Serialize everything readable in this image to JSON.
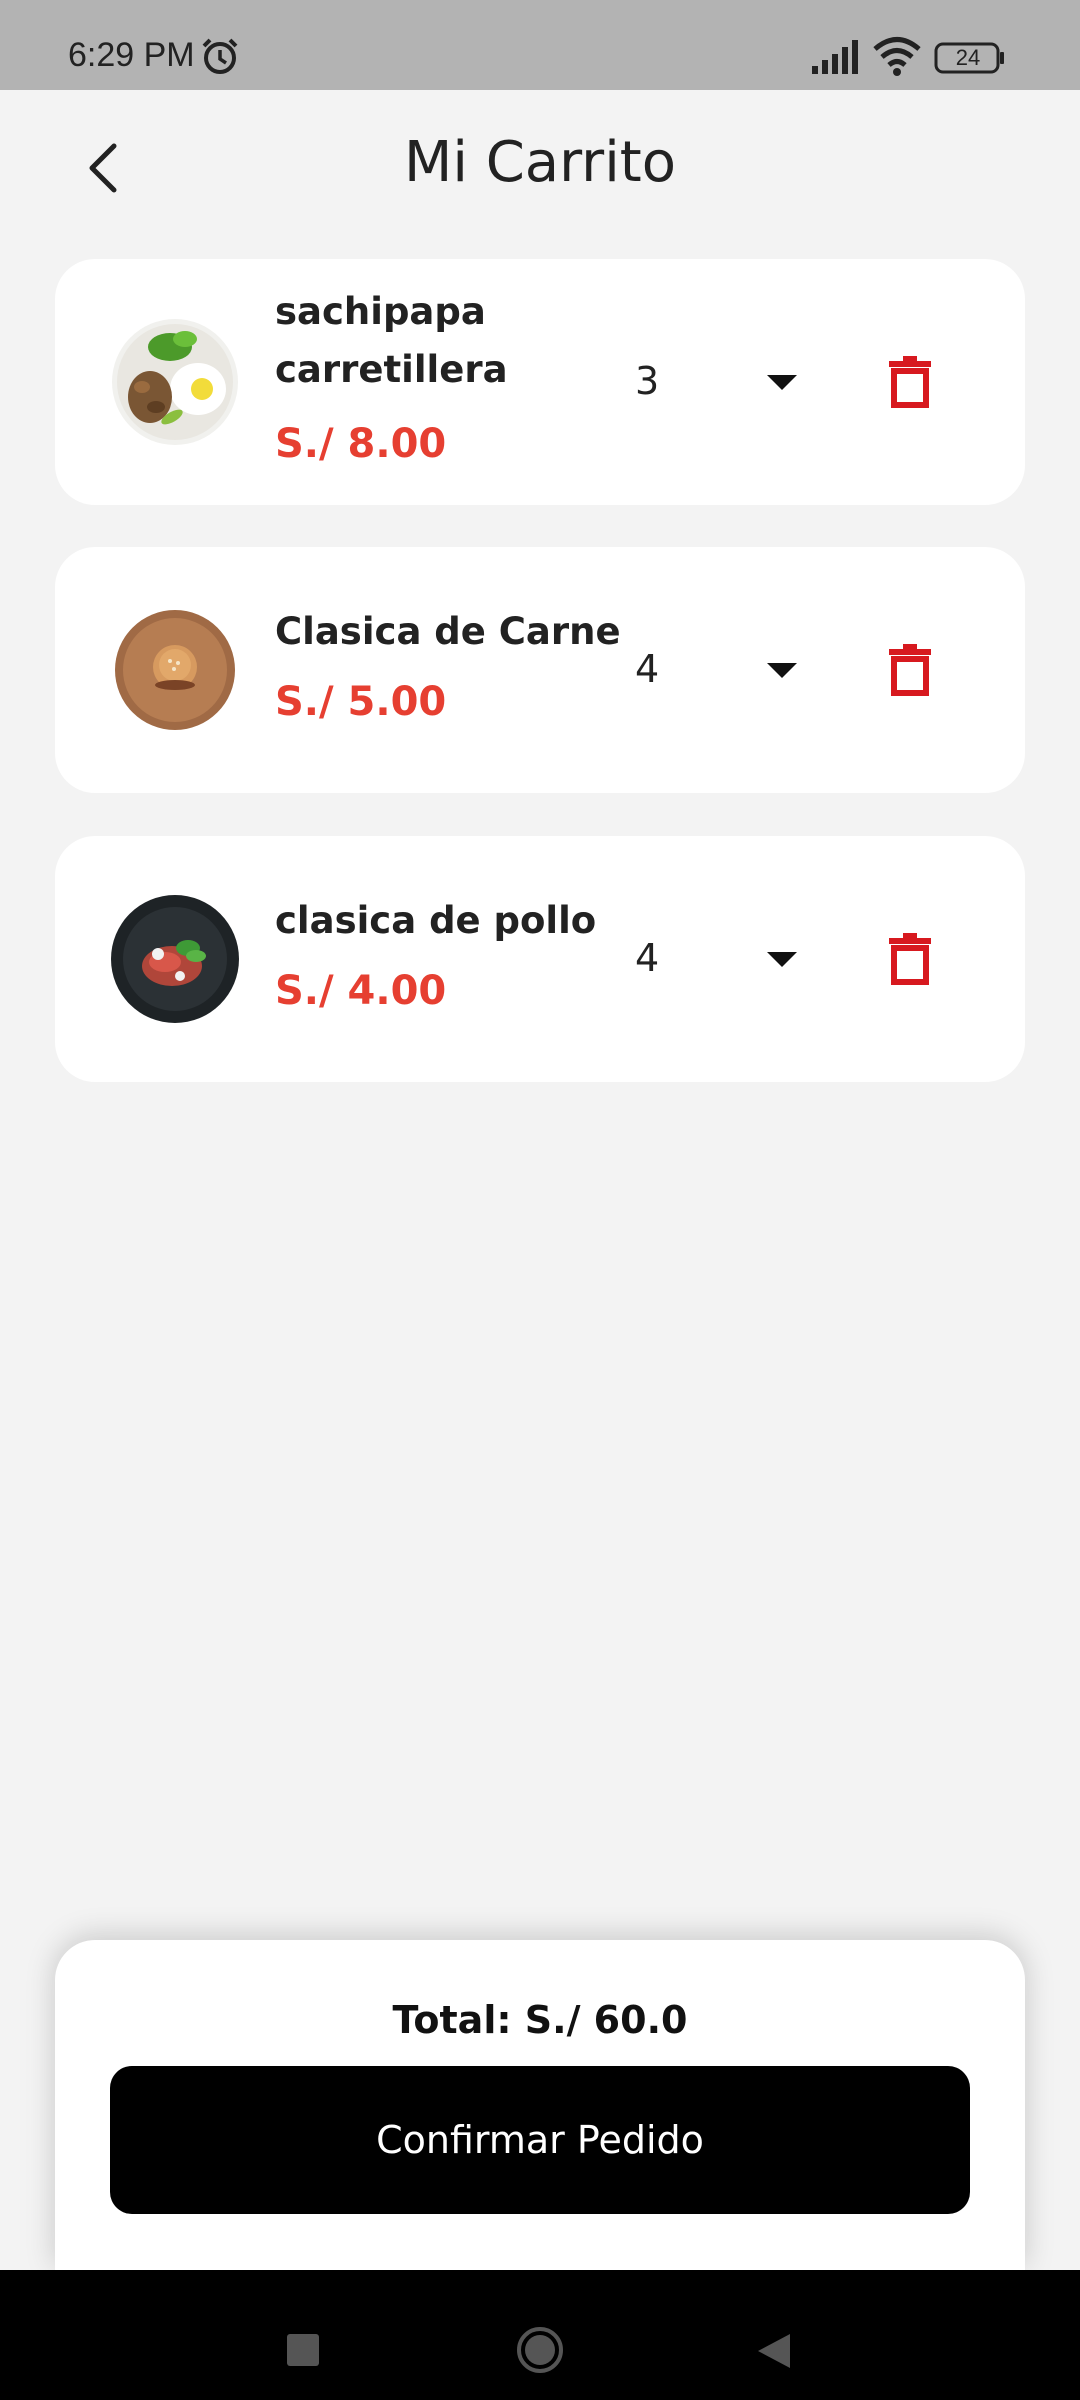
{
  "status_bar": {
    "time": "6:29 PM",
    "battery": "24",
    "icons": [
      "alarm-icon",
      "signal-icon",
      "wifi-icon",
      "battery-icon"
    ]
  },
  "header": {
    "title": "Mi Carrito",
    "back_icon": "chevron-left-icon"
  },
  "cart": {
    "items": [
      {
        "name": "sachipapa carretillera",
        "price": "S./ 8.00",
        "quantity": "3"
      },
      {
        "name": "Clasica de Carne",
        "price": "S./ 5.00",
        "quantity": "4"
      },
      {
        "name": "clasica de pollo",
        "price": "S./ 4.00",
        "quantity": "4"
      }
    ]
  },
  "footer": {
    "total": "Total: S./ 60.0",
    "confirm_label": "Confirmar Pedido"
  },
  "colors": {
    "accent_red": "#e63f31",
    "delete_red": "#d7191f",
    "background": "#f3f3f3",
    "button_black": "#000000"
  }
}
